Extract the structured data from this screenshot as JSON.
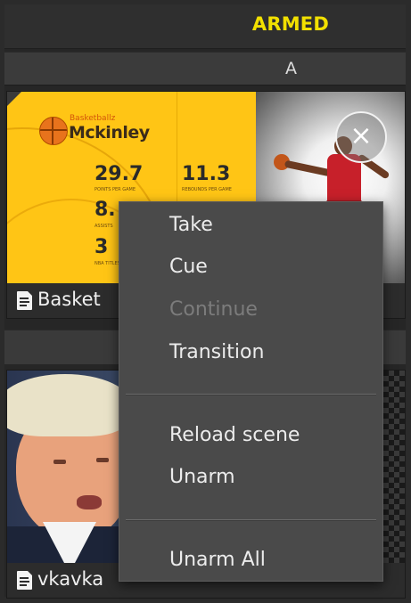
{
  "header": {
    "status": "ARMED"
  },
  "slot": {
    "label": "A"
  },
  "card_a": {
    "brand": "Basketballz",
    "player": "Mckinley",
    "stats": [
      {
        "value": "29.7",
        "caption": "POINTS PER GAME"
      },
      {
        "value": "11.3",
        "caption": "REBOUNDS PER GAME"
      },
      {
        "value": "8.",
        "caption": "ASSISTS"
      },
      {
        "value": "3",
        "caption": "NBA TITLES"
      }
    ],
    "close_symbol": "×",
    "caption": "Basket"
  },
  "card_b": {
    "caption": "vkavka"
  },
  "context_menu": {
    "take": "Take",
    "cue": "Cue",
    "continue": "Continue",
    "transition": "Transition",
    "reload_scene": "Reload scene",
    "unarm": "Unarm",
    "unarm_all": "Unarm All"
  },
  "colors": {
    "armed": "#f2e000",
    "menu_bg": "#4a4a4a",
    "card_yellow": "#ffc515"
  },
  "icons": [
    "close-icon",
    "document-icon",
    "basketball-icon"
  ]
}
